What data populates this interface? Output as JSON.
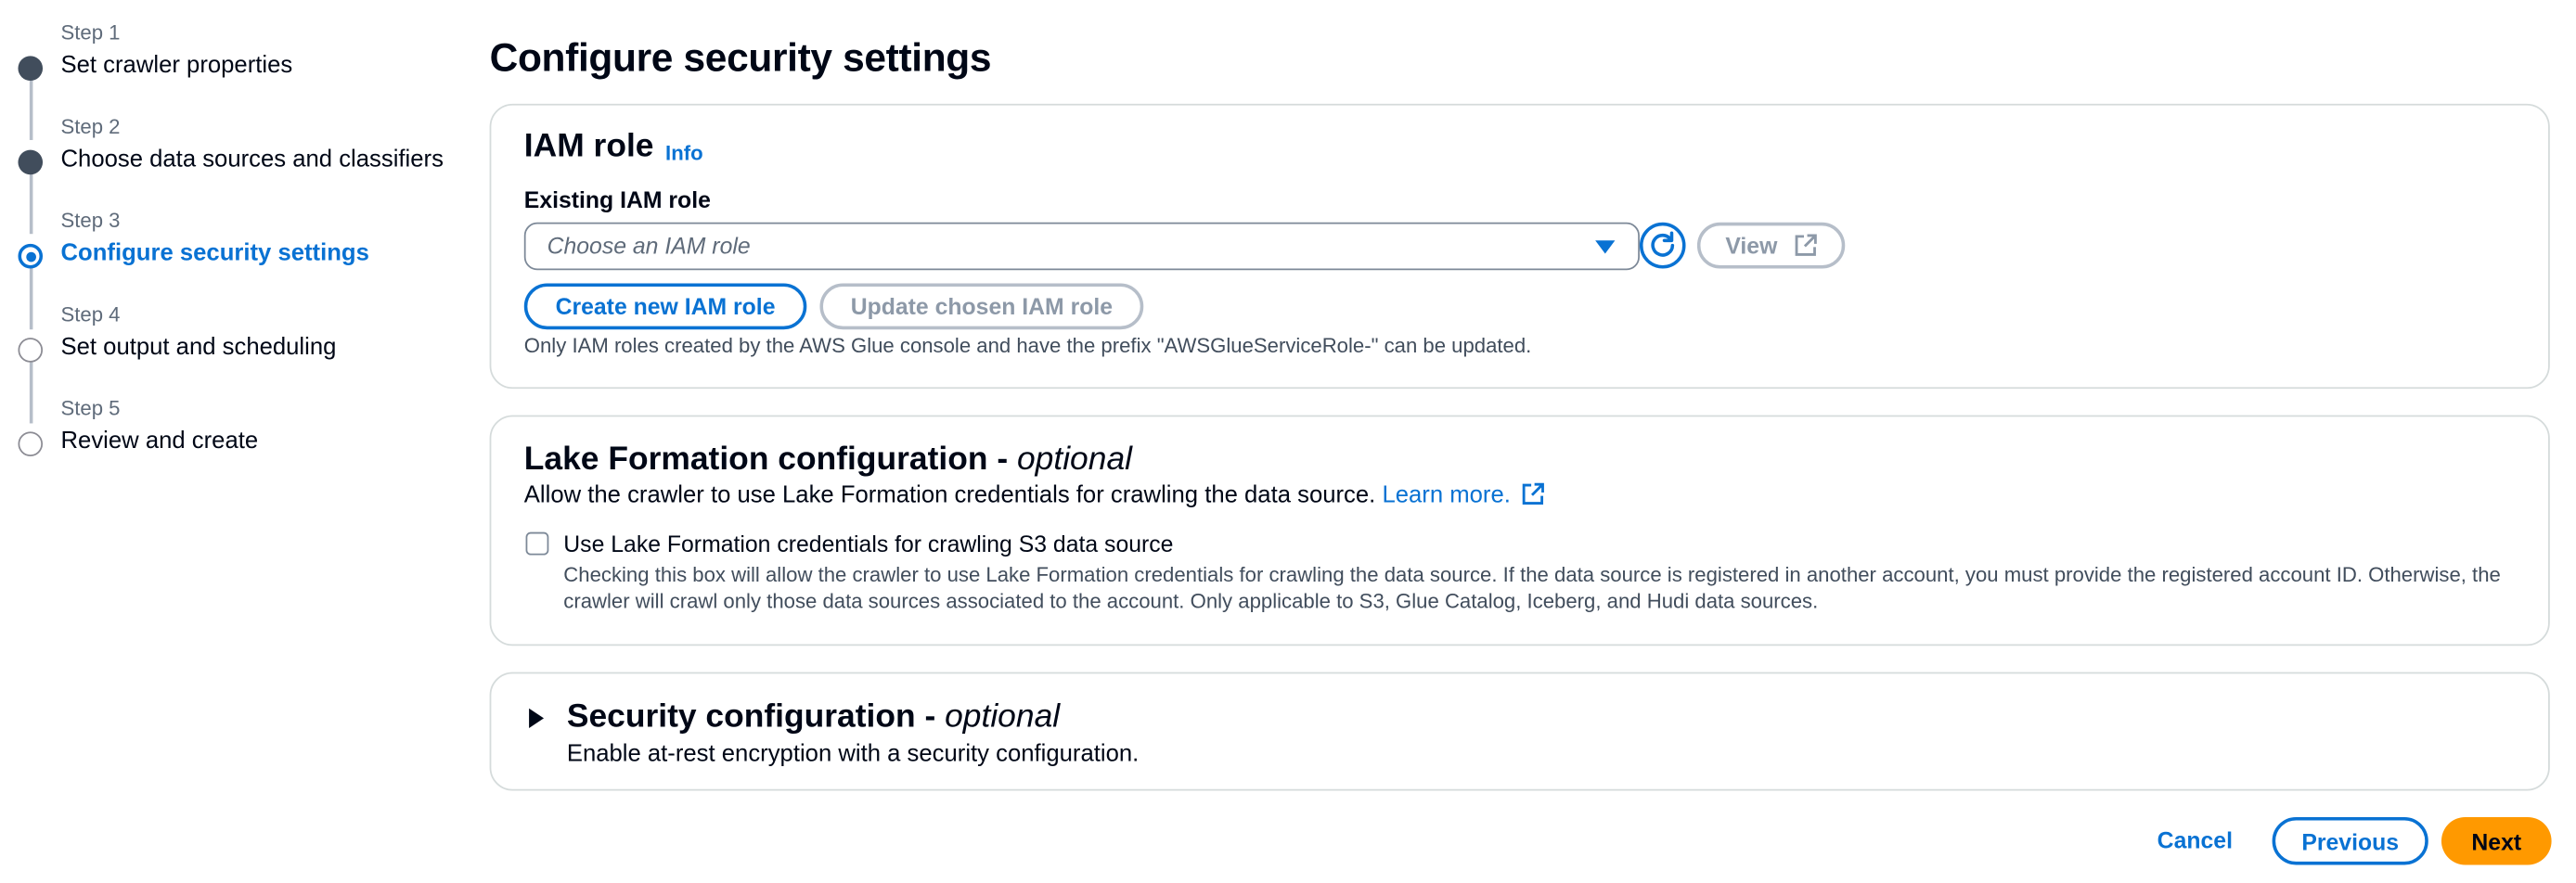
{
  "wizard": {
    "steps": [
      {
        "number": "Step 1",
        "label": "Set crawler properties",
        "state": "done"
      },
      {
        "number": "Step 2",
        "label": "Choose data sources and classifiers",
        "state": "done"
      },
      {
        "number": "Step 3",
        "label": "Configure security settings",
        "state": "current"
      },
      {
        "number": "Step 4",
        "label": "Set output and scheduling",
        "state": "todo"
      },
      {
        "number": "Step 5",
        "label": "Review and create",
        "state": "todo"
      }
    ]
  },
  "page": {
    "title": "Configure security settings"
  },
  "iam": {
    "title": "IAM role",
    "info": "Info",
    "field_label": "Existing IAM role",
    "select_placeholder": "Choose an IAM role",
    "view_label": "View",
    "create_label": "Create new IAM role",
    "update_label": "Update chosen IAM role",
    "help": "Only IAM roles created by the AWS Glue console and have the prefix \"AWSGlueServiceRole-\" can be updated."
  },
  "lake": {
    "title": "Lake Formation configuration - ",
    "title_optional": "optional",
    "description": "Allow the crawler to use Lake Formation credentials for crawling the data source.",
    "learn_more": "Learn more.",
    "checkbox_label": "Use Lake Formation credentials for crawling S3 data source",
    "checkbox_checked": false,
    "checkbox_description": "Checking this box will allow the crawler to use Lake Formation credentials for crawling the data source. If the data source is registered in another account, you must provide the registered account ID. Otherwise, the crawler will crawl only those data sources associated to the account. Only applicable to S3, Glue Catalog, Iceberg, and Hudi data sources."
  },
  "security": {
    "title": "Security configuration - ",
    "title_optional": "optional",
    "description": "Enable at-rest encryption with a security configuration."
  },
  "footer": {
    "cancel": "Cancel",
    "previous": "Previous",
    "next": "Next"
  },
  "colors": {
    "accent": "#0972d3",
    "primary_button": "#ff9900",
    "text": "#000716"
  }
}
